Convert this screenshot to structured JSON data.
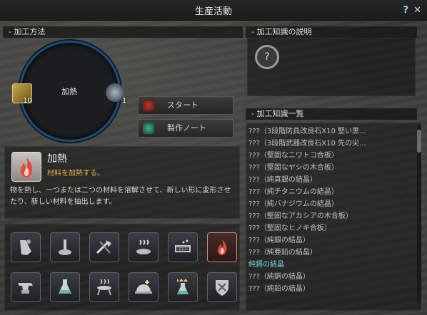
{
  "window": {
    "title": "生産活動",
    "help_label": "?",
    "close_label": "✕"
  },
  "process": {
    "section_title": "- 加工方法",
    "ring_label": "加熱",
    "left_item": {
      "icon": "gold-bar-icon",
      "count": "10"
    },
    "right_item": {
      "icon": "ore-icon",
      "count": "1"
    },
    "start_label": "スタート",
    "note_label": "製作ノート"
  },
  "recipe": {
    "name": "加熱",
    "subtitle": "材料を加熱する。",
    "description": "物を熱し、一つまたは二つの材料を溶解させて、新しい形に変形させたり、新しい材料を抽出します。",
    "icon": "flame-icon"
  },
  "method_icons": [
    {
      "name": "shaking-icon"
    },
    {
      "name": "grinding-icon"
    },
    {
      "name": "chopping-icon"
    },
    {
      "name": "drying-icon"
    },
    {
      "name": "filtering-icon"
    },
    {
      "name": "heating-icon",
      "selected": true
    },
    {
      "name": "anvil-icon"
    },
    {
      "name": "alchemy-icon"
    },
    {
      "name": "grill-icon"
    },
    {
      "name": "cooking-icon"
    },
    {
      "name": "simple-alchemy-icon"
    },
    {
      "name": "guild-manufacture-icon"
    }
  ],
  "knowledge_desc": {
    "section_title": "- 加工知識の説明",
    "placeholder_glyph": "?"
  },
  "knowledge_list": {
    "section_title": "- 加工知識一覧",
    "items": [
      "???（3段階防具改良石X10 堅い黒...",
      "???（3段階武器改良石X10 先の尖...",
      "???（堅固なニワトコ合板）",
      "???（堅固なヤシの木合板）",
      "???（純真銀の結晶）",
      "???（純チタニウムの結晶）",
      "???（純バナジウムの結晶）",
      "???（堅固なアカシアの木合板）",
      "???（堅固なヒノキ合板）",
      "???（純銀の結晶）",
      "???（純亜鉛の結晶）",
      "純錫の結晶",
      "???（純銅の結晶）",
      "???（純鉛の結晶）"
    ],
    "active_index": 11
  },
  "colors": {
    "accent": "#76d5dc",
    "ring": "#1d4a7a",
    "subtitle": "#e6b24c"
  }
}
